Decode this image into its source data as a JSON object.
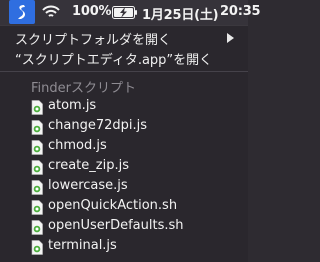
{
  "menubar": {
    "active_app_icon": "script-menu-icon",
    "wifi_icon": "wifi-icon",
    "battery_percent": "100%",
    "battery_icon": "battery-charging-icon",
    "date": "1月25日(土)",
    "time": "20:35"
  },
  "menu": {
    "items": [
      {
        "label": "スクリプトフォルダを開く",
        "submenu": true
      },
      {
        "label": "“スクリプトエディタ.app”を開く",
        "submenu": false
      }
    ],
    "section_title": "Finderスクリプト",
    "files": [
      {
        "label": "atom.js",
        "icon": "js-script-icon"
      },
      {
        "label": "change72dpi.js",
        "icon": "js-script-icon"
      },
      {
        "label": "chmod.js",
        "icon": "js-script-icon"
      },
      {
        "label": "create_zip.js",
        "icon": "js-script-icon"
      },
      {
        "label": "lowercase.js",
        "icon": "js-script-icon"
      },
      {
        "label": "openQuickAction.sh",
        "icon": "shell-script-icon"
      },
      {
        "label": "openUserDefaults.sh",
        "icon": "shell-script-icon"
      },
      {
        "label": "terminal.js",
        "icon": "js-script-icon"
      }
    ]
  },
  "colors": {
    "menubar_bg": "#36333a",
    "active_highlight": "#2f6ee0",
    "menu_bg": "#2a272d",
    "section_text": "#8f8c93"
  }
}
